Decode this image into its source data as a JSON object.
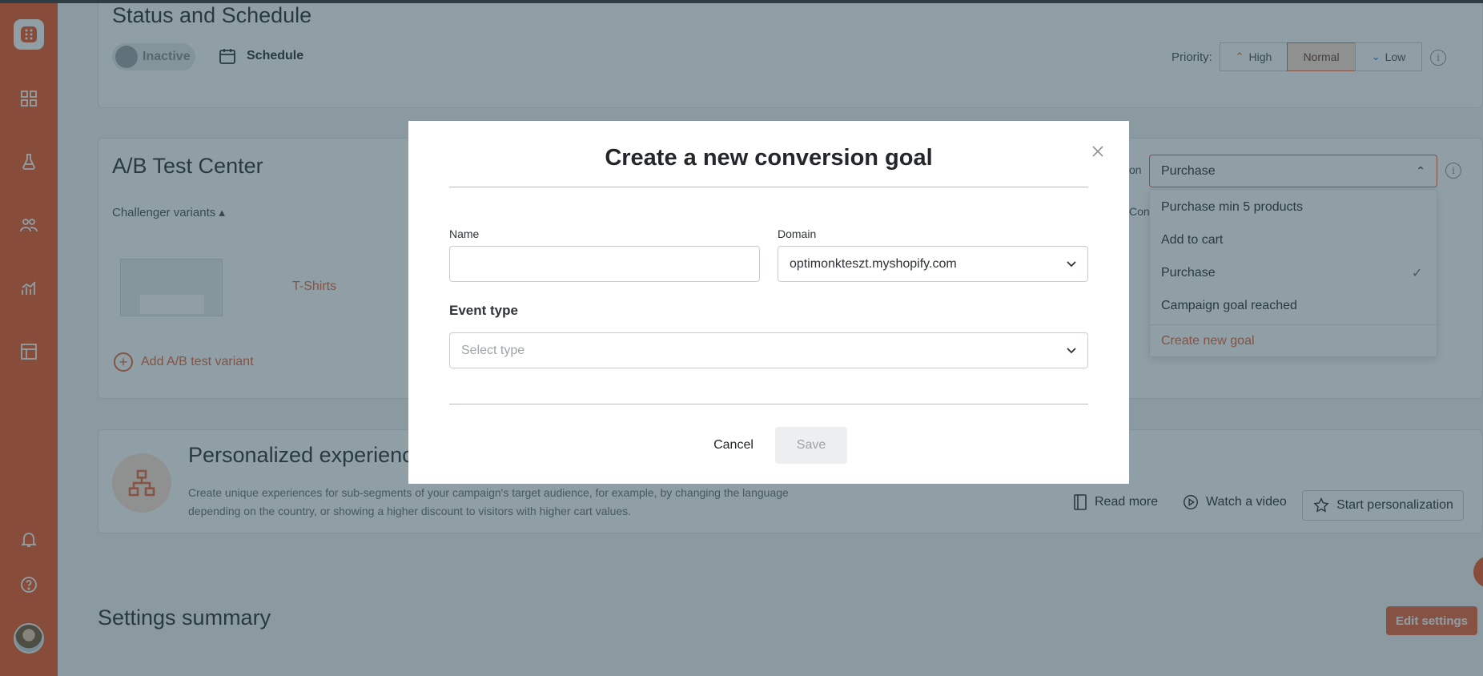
{
  "status_section": {
    "title": "Status and Schedule",
    "toggle_label": "Inactive",
    "schedule_label": "Schedule",
    "priority_label": "Priority:",
    "priority_options": [
      "High",
      "Normal",
      "Low"
    ],
    "priority_selected": "Normal"
  },
  "ab_section": {
    "title": "A/B Test Center",
    "challenger_label": "Challenger variants",
    "variant_name": "T-Shirts",
    "add_variant_label": "Add A/B test variant",
    "on_label": "on",
    "con_label": "Con"
  },
  "goal_dropdown": {
    "selected": "Purchase",
    "options": [
      "Purchase min 5 products",
      "Add to cart",
      "Purchase",
      "Campaign goal reached"
    ],
    "create_new": "Create new goal"
  },
  "personalized": {
    "title": "Personalized experiences",
    "description": "Create unique experiences for sub-segments of your campaign's target audience, for example, by changing the language depending on the country, or showing a higher discount to visitors with higher cart values.",
    "read_more": "Read more",
    "watch_video": "Watch a video",
    "start": "Start personalization"
  },
  "summary": {
    "title": "Settings summary",
    "edit_button": "Edit settings"
  },
  "modal": {
    "title": "Create a new conversion goal",
    "name_label": "Name",
    "name_value": "",
    "domain_label": "Domain",
    "domain_value": "optimonkteszt.myshopify.com",
    "event_type_label": "Event type",
    "event_type_placeholder": "Select type",
    "cancel": "Cancel",
    "save": "Save"
  },
  "colors": {
    "brand": "#ed5a29",
    "overlay": "#22404c"
  },
  "icons": [
    "app-logo-icon",
    "dashboard-icon",
    "flask-icon",
    "users-icon",
    "analytics-icon",
    "templates-icon",
    "bell-icon",
    "help-icon"
  ]
}
